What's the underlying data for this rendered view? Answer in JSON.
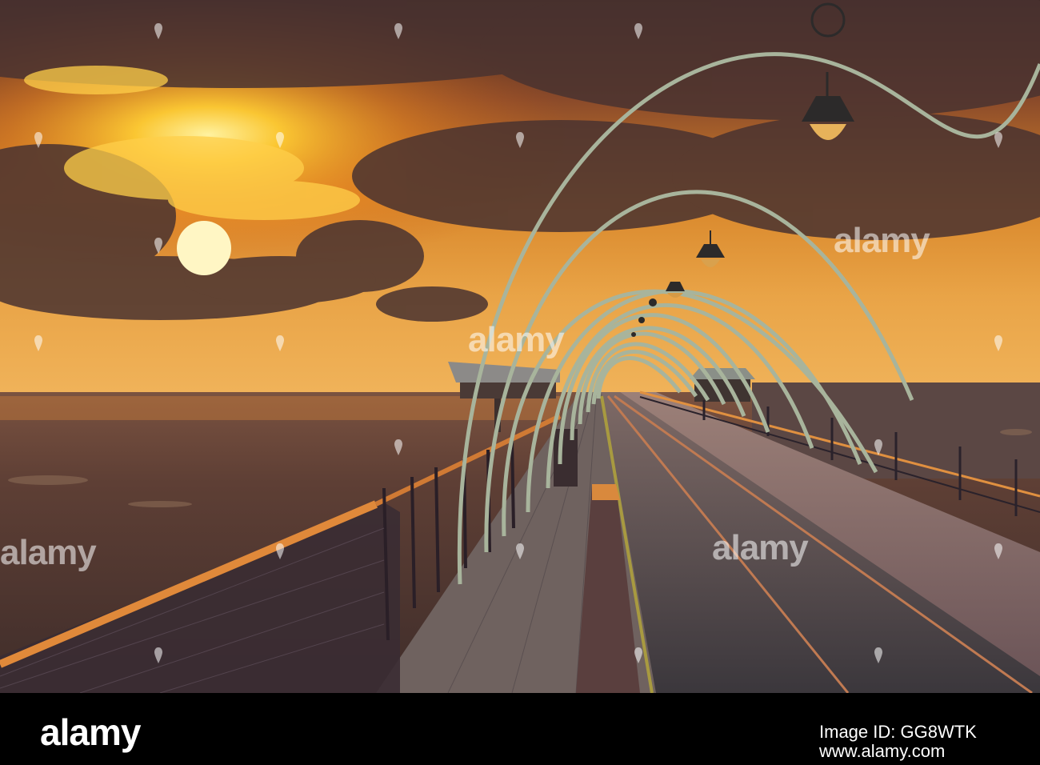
{
  "watermark": {
    "brand": "alamy"
  },
  "footer": {
    "logo": "alamy",
    "image_id": "Image ID: GG8WTK",
    "url": "www.alamy.com"
  },
  "colors": {
    "sky_top": "#4a2a25",
    "sun": "#ffd34a",
    "sand": "#5a3e34",
    "deck": "#5b5156",
    "arch": "#a8b49c"
  },
  "icons": [
    "watermark-pin-icon",
    "lamp-icon"
  ]
}
